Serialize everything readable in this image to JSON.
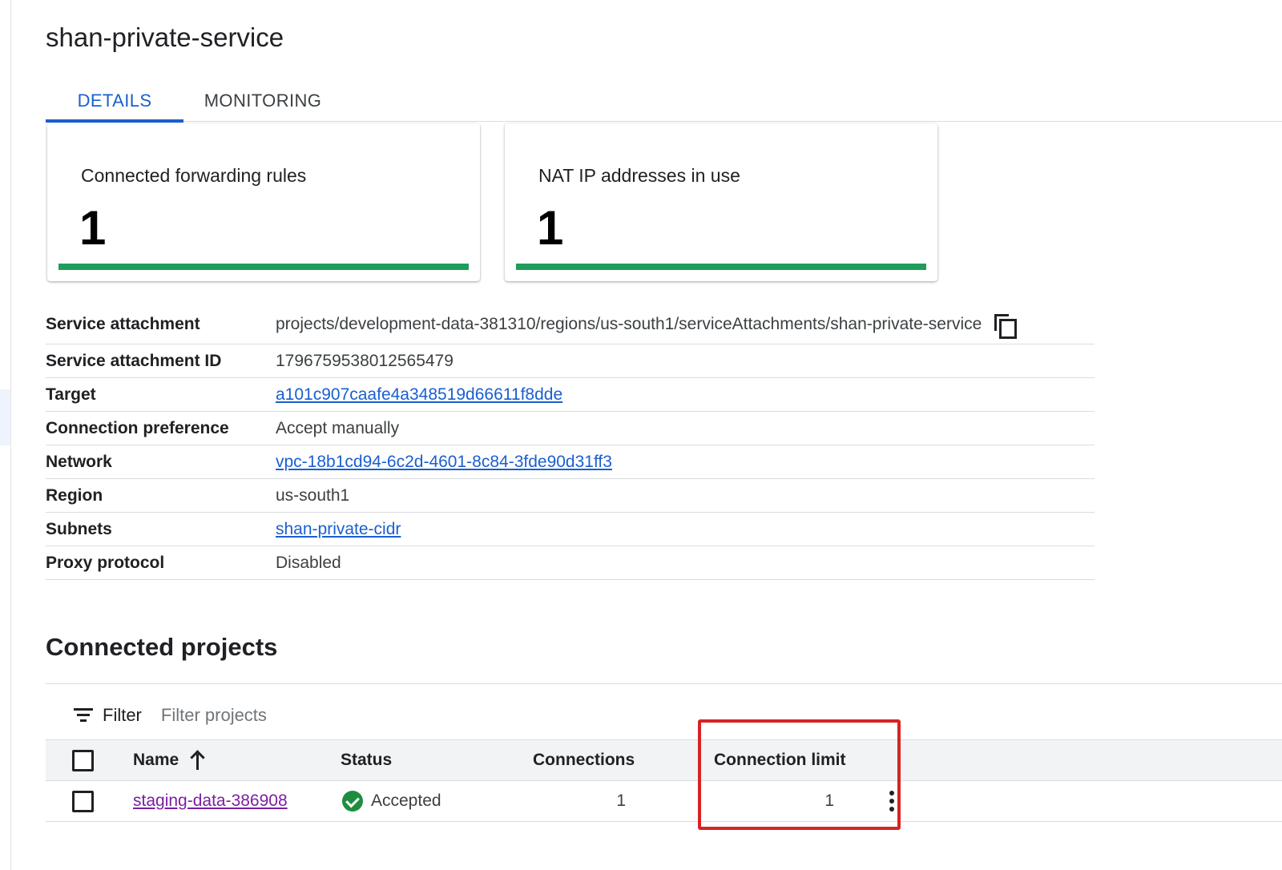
{
  "page": {
    "title": "shan-private-service"
  },
  "tabs": [
    {
      "label": "DETAILS",
      "active": true
    },
    {
      "label": "MONITORING",
      "active": false
    }
  ],
  "cards": [
    {
      "label": "Connected forwarding rules",
      "value": "1"
    },
    {
      "label": "NAT IP addresses in use",
      "value": "1"
    }
  ],
  "details": [
    {
      "label": "Service attachment",
      "value": "projects/development-data-381310/regions/us-south1/serviceAttachments/shan-private-service"
    },
    {
      "label": "Service attachment ID",
      "value": "1796759538012565479"
    },
    {
      "label": "Target",
      "value": "a101c907caafe4a348519d66611f8dde"
    },
    {
      "label": "Connection preference",
      "value": "Accept manually"
    },
    {
      "label": "Network",
      "value": "vpc-18b1cd94-6c2d-4601-8c84-3fde90d31ff3"
    },
    {
      "label": "Region",
      "value": "us-south1"
    },
    {
      "label": "Subnets",
      "value": "shan-private-cidr"
    },
    {
      "label": "Proxy protocol",
      "value": "Disabled"
    }
  ],
  "connected_projects": {
    "title": "Connected projects",
    "filter": {
      "label": "Filter",
      "placeholder": "Filter projects"
    },
    "columns": {
      "name": "Name",
      "status": "Status",
      "connections": "Connections",
      "connection_limit": "Connection limit"
    },
    "rows": [
      {
        "name": "staging-data-386908",
        "status": "Accepted",
        "connections": "1",
        "connection_limit": "1"
      }
    ]
  },
  "colors": {
    "accent_blue": "#1a5fd0",
    "success_green": "#1e8e3e",
    "usage_bar": "#1e9e5a",
    "visited_link": "#7b1fa2",
    "highlight_red": "#d62424"
  },
  "icons": {
    "copy": "copy-icon",
    "filter": "filter-icon",
    "sort": "arrow-up-icon",
    "status": "check-circle-icon",
    "more": "more-vert-icon"
  }
}
